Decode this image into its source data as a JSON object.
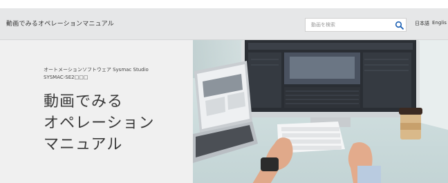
{
  "header": {
    "site_title": "動画でみるオペレーションマニュアル",
    "search": {
      "placeholder": "動画を検索",
      "icon": "search-icon"
    },
    "languages": [
      {
        "label": "日本語"
      },
      {
        "label": "Englis"
      }
    ]
  },
  "hero": {
    "subtitle_line1": "オートメーションソフトウェア Sysmac Studio",
    "subtitle_line2": "SYSMAC-SE2□□□",
    "title_lines": [
      "動画でみる",
      "オペレーション",
      "マニュアル"
    ]
  },
  "colors": {
    "header_bg": "#e6e7e8",
    "hero_left_bg": "#f0f0f0",
    "search_icon": "#1a5fb4",
    "title_text": "#3a3a3a"
  }
}
